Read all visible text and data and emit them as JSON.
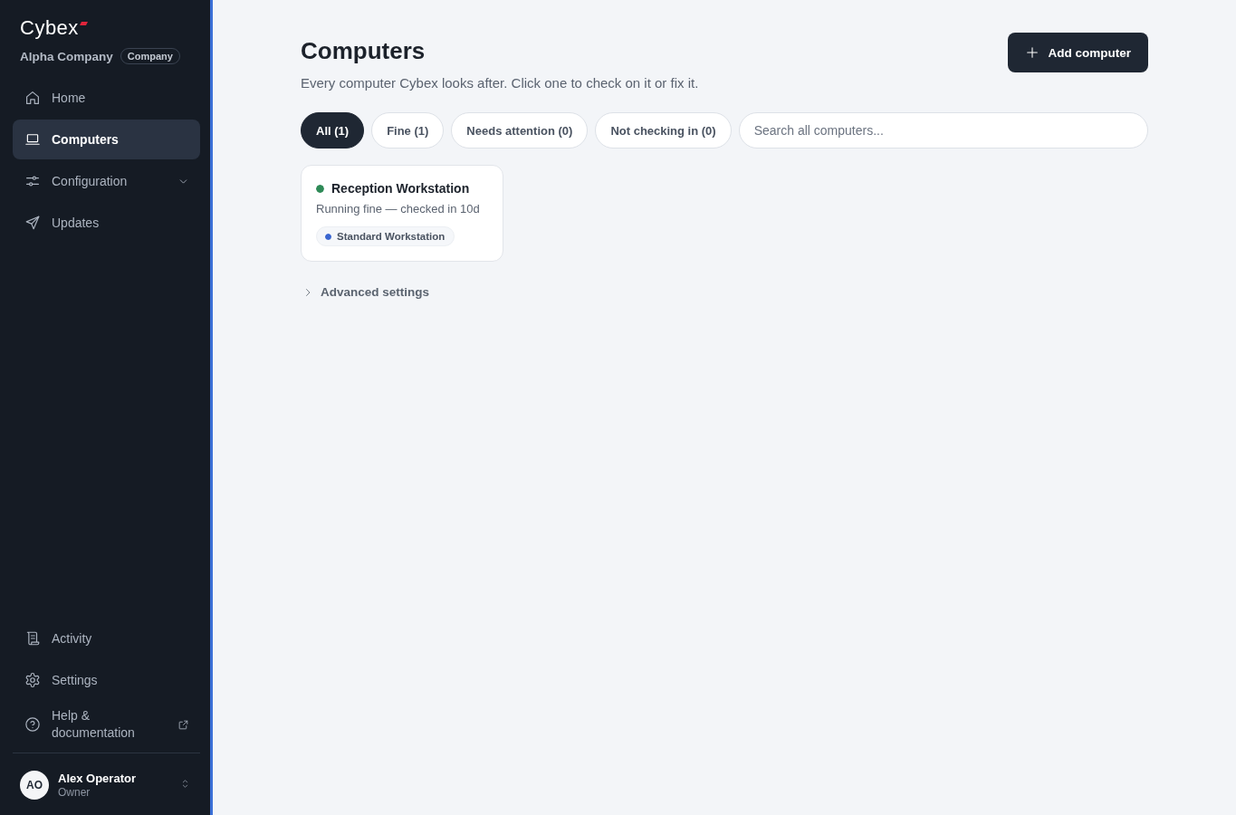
{
  "sidebar": {
    "logo": "Cybex",
    "org": {
      "name": "Alpha Company",
      "type": "Company"
    },
    "nav": [
      {
        "label": "Home",
        "kind": "link",
        "selected": false
      },
      {
        "label": "Computers",
        "kind": "link",
        "selected": true
      },
      {
        "label": "Configuration",
        "kind": "group",
        "selected": false,
        "expanded": false
      },
      {
        "label": "Updates",
        "kind": "link",
        "selected": false
      }
    ],
    "footer_nav": [
      {
        "label": "Activity",
        "kind": "link"
      },
      {
        "label": "Settings",
        "kind": "link"
      },
      {
        "label": "Help & documentation",
        "kind": "external"
      }
    ],
    "user": {
      "initials": "AO",
      "name": "Alex Operator",
      "role": "Owner"
    }
  },
  "page": {
    "title": "Computers",
    "subtitle": "Every computer Cybex looks after. Click one to check on it or fix it.",
    "add_button": "Add computer"
  },
  "filters": [
    {
      "label": "All (1)",
      "selected": true
    },
    {
      "label": "Fine (1)",
      "selected": false
    },
    {
      "label": "Needs attention (0)",
      "selected": false
    },
    {
      "label": "Not checking in (0)",
      "selected": false
    }
  ],
  "search": {
    "placeholder": "Search all computers..."
  },
  "computers": [
    {
      "name": "Reception Workstation",
      "color": "#2e8a57",
      "status": "Running fine — checked in 10d",
      "profile": {
        "label": "Standard Workstation",
        "color": "#3a66d0"
      }
    }
  ],
  "advanced": {
    "label": "Advanced settings",
    "expanded": false
  }
}
